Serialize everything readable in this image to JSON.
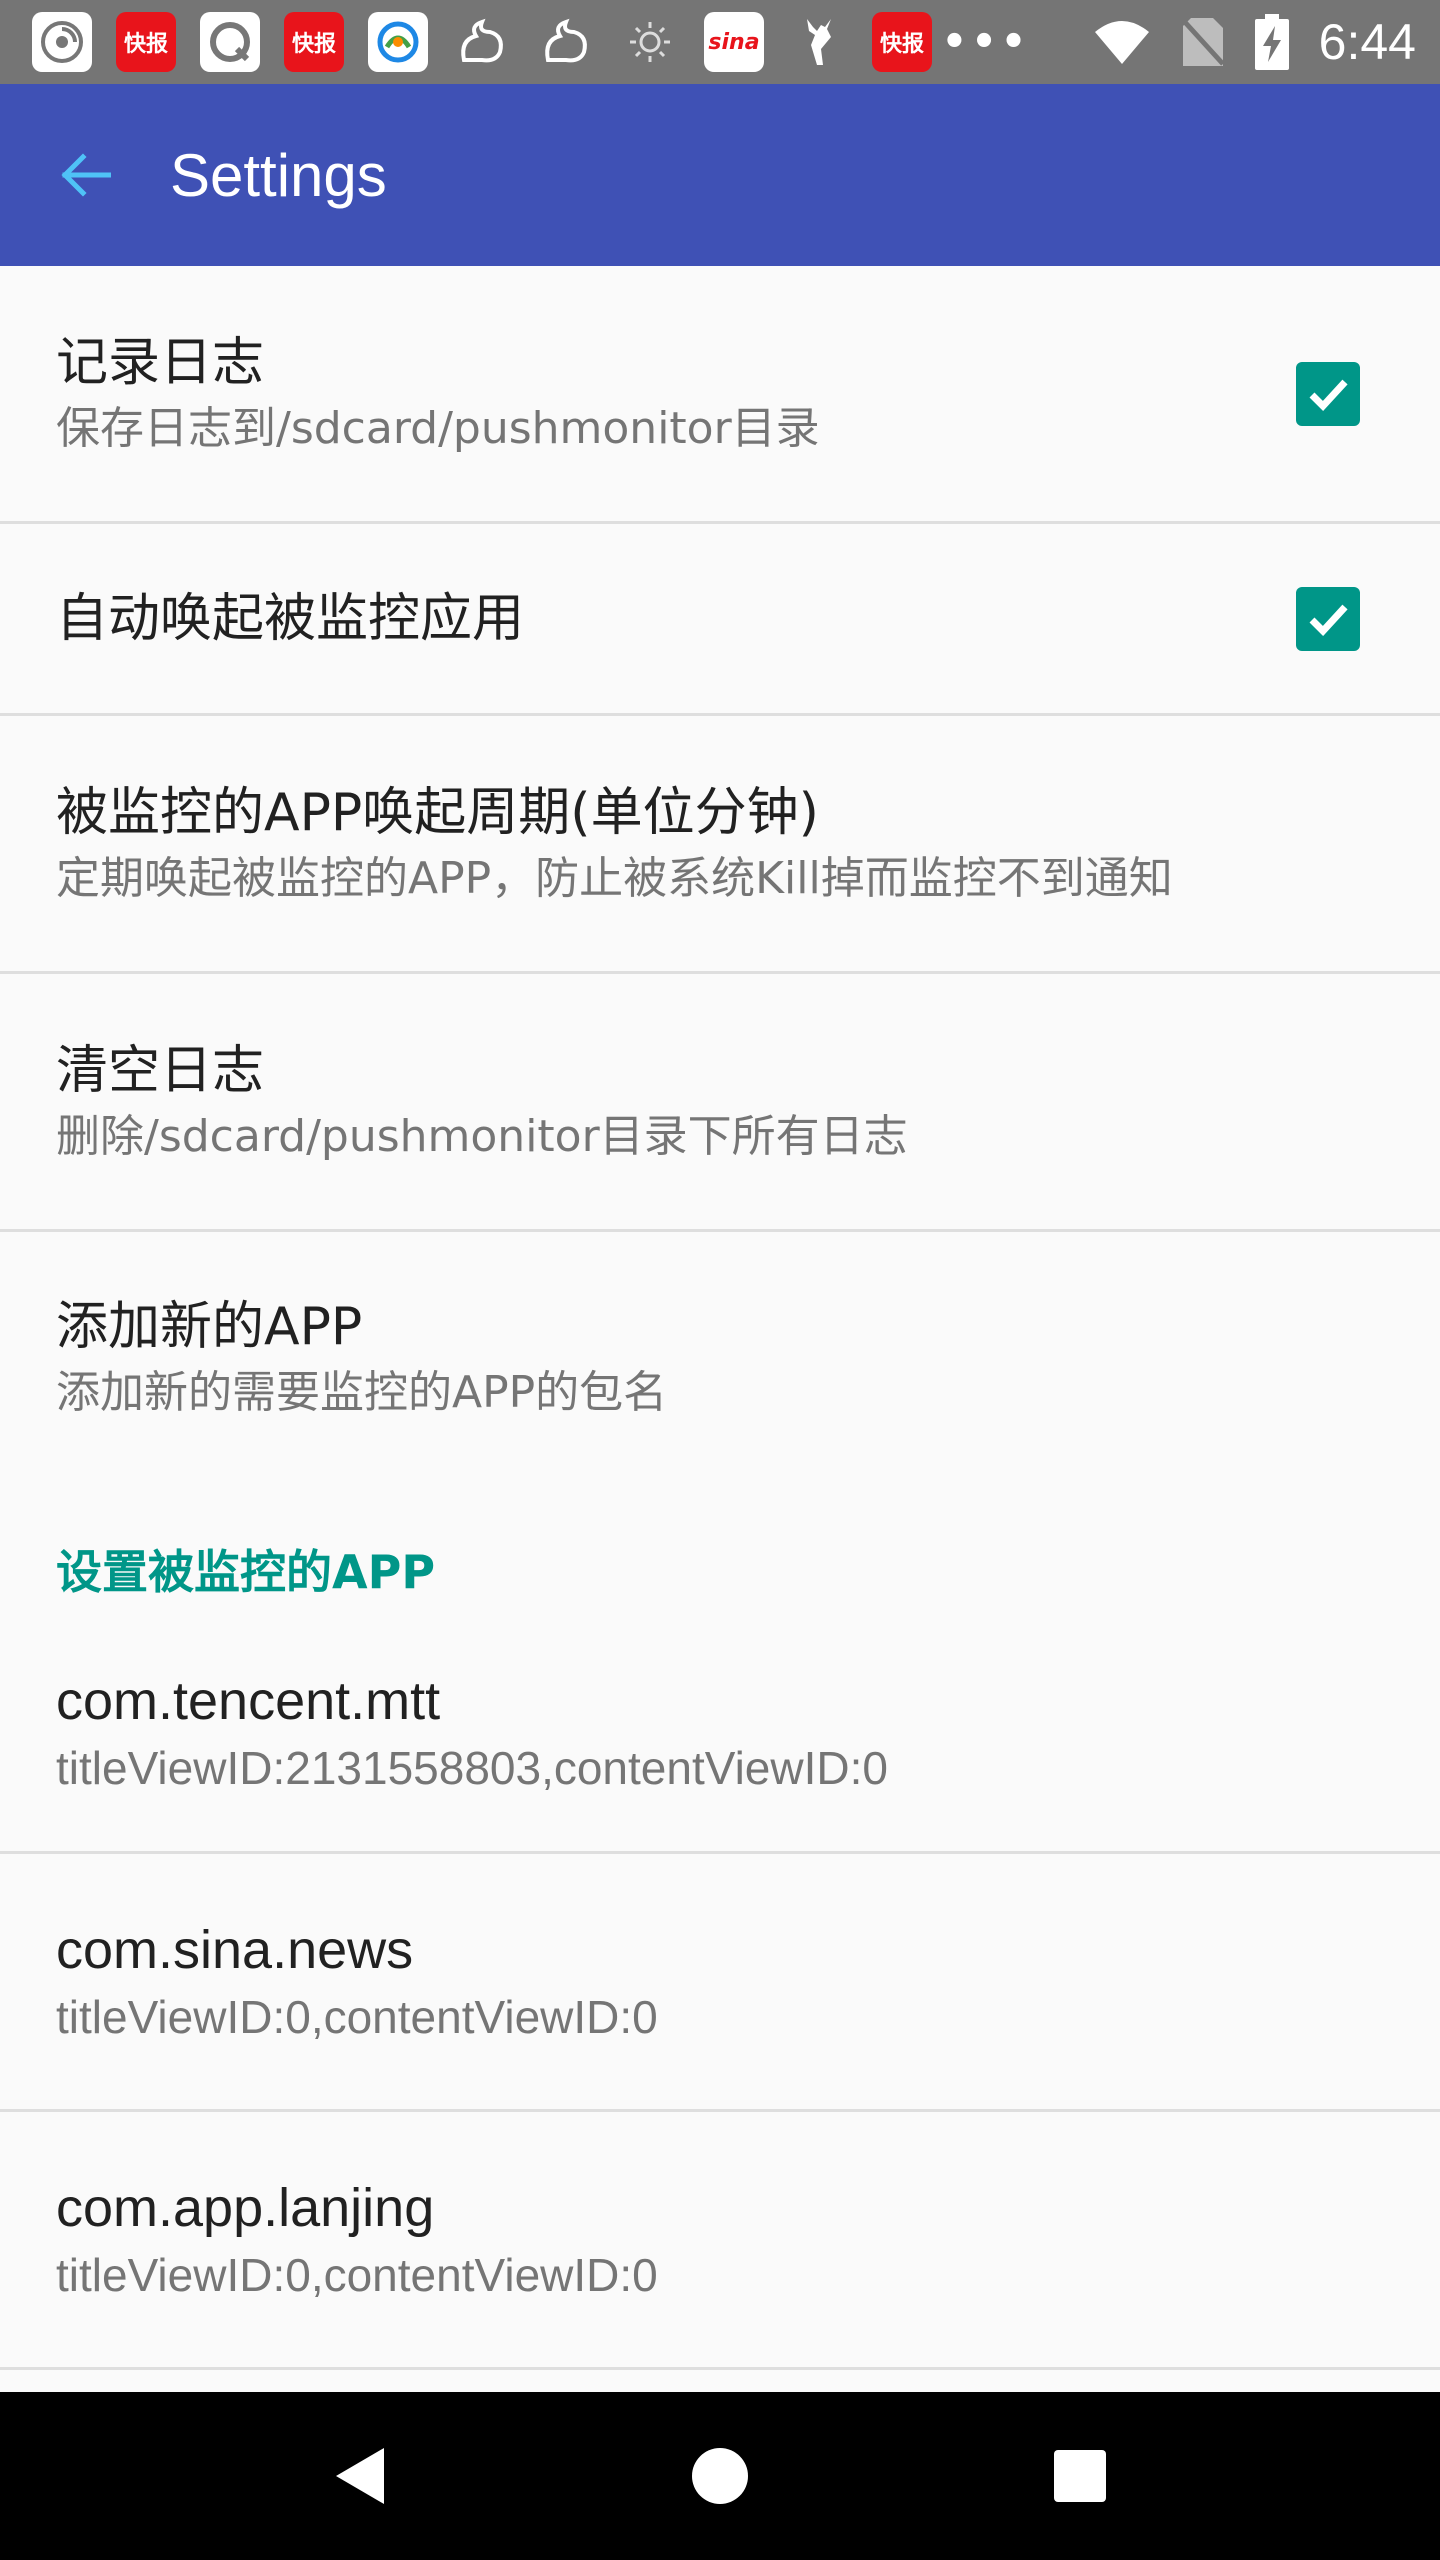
{
  "status_bar": {
    "notifications": [
      {
        "icon": "spiral-app-icon",
        "style": "white-bg",
        "label": ""
      },
      {
        "icon": "kuaibao-icon",
        "style": "red-bg",
        "label": "快报"
      },
      {
        "icon": "qq-browser-icon",
        "style": "white-bg",
        "label": ""
      },
      {
        "icon": "kuaibao-icon",
        "style": "red-bg",
        "label": "快报"
      },
      {
        "icon": "tencent-news-icon",
        "style": "white-bg",
        "label": ""
      },
      {
        "icon": "uc-squirrel-icon",
        "style": "plain",
        "label": ""
      },
      {
        "icon": "uc-squirrel-icon",
        "style": "plain",
        "label": ""
      },
      {
        "icon": "brightness-icon",
        "style": "plain",
        "label": ""
      },
      {
        "icon": "sina-icon",
        "style": "white-bg",
        "label": "sina"
      },
      {
        "icon": "deer-icon",
        "style": "plain",
        "label": ""
      },
      {
        "icon": "kuaibao-icon",
        "style": "red-bg",
        "label": "快报"
      }
    ],
    "time": "6:44"
  },
  "app_bar": {
    "title": "Settings"
  },
  "preferences": [
    {
      "title": "记录日志",
      "summary": "保存日志到/sdcard/pushmonitor目录",
      "checked": true
    },
    {
      "title": "自动唤起被监控应用",
      "summary": "",
      "checked": true
    },
    {
      "title": "被监控的APP唤起周期(单位分钟)",
      "summary": "定期唤起被监控的APP，防止被系统Kill掉而监控不到通知"
    },
    {
      "title": "清空日志",
      "summary": "删除/sdcard/pushmonitor目录下所有日志"
    },
    {
      "title": "添加新的APP",
      "summary": "添加新的需要监控的APP的包名"
    }
  ],
  "category": {
    "title": "设置被监控的APP"
  },
  "monitored_apps": [
    {
      "title": "com.tencent.mtt",
      "summary": "titleViewID:2131558803,contentViewID:0"
    },
    {
      "title": "com.sina.news",
      "summary": "titleViewID:0,contentViewID:0"
    },
    {
      "title": "com.app.lanjing",
      "summary": "titleViewID:0,contentViewID:0"
    }
  ],
  "colors": {
    "primary": "#3f51b5",
    "accent": "#009688",
    "status_bar": "#757575"
  }
}
